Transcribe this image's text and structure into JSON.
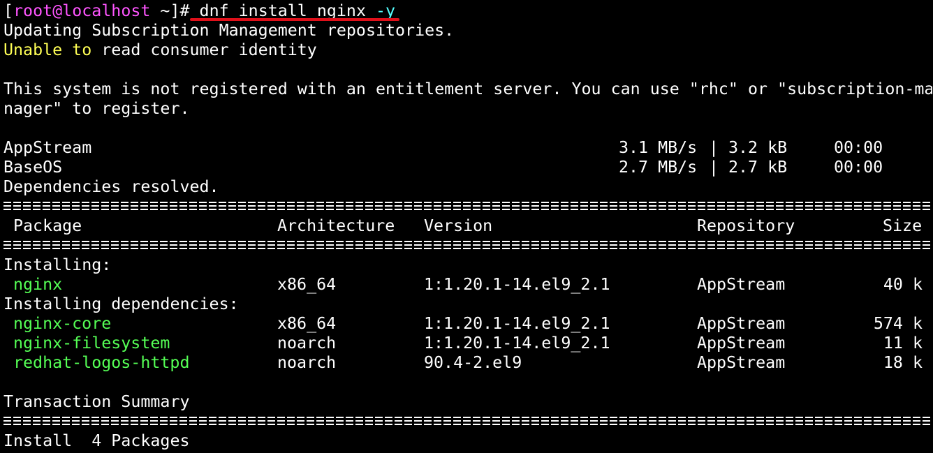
{
  "prompt": {
    "open_bracket": "[",
    "user": "root",
    "at": "@",
    "host": "localhost",
    "cwd_and_symbol": " ~]# ",
    "cmd_main": "dnf install nginx ",
    "cmd_flag": "-y"
  },
  "messages": {
    "updating": "Updating Subscription Management repositories.",
    "unable_word1": "Unable",
    "unable_word2": " to",
    "unable_rest": " read consumer identity",
    "not_registered_line1": "This system is not registered with an entitlement server. You can use \"rhc\" or \"subscription-ma",
    "not_registered_line2": "nager\" to register.",
    "deps_resolved": "Dependencies resolved."
  },
  "repos": [
    {
      "name": "AppStream",
      "speed": "3.1 MB/s",
      "sep": "|",
      "size": "3.2 kB",
      "time": "00:00"
    },
    {
      "name": "BaseOS",
      "speed": "2.7 MB/s",
      "sep": "|",
      "size": "2.7 kB",
      "time": "00:00"
    }
  ],
  "table": {
    "headers": {
      "package": "Package",
      "arch": "Architecture",
      "version": "Version",
      "repo": "Repository",
      "size": "Size"
    },
    "section_installing": "Installing:",
    "section_deps": "Installing dependencies:",
    "installing": [
      {
        "package": "nginx",
        "arch": "x86_64",
        "version": "1:1.20.1-14.el9_2.1",
        "repo": "AppStream",
        "size": "40 k"
      }
    ],
    "dependencies": [
      {
        "package": "nginx-core",
        "arch": "x86_64",
        "version": "1:1.20.1-14.el9_2.1",
        "repo": "AppStream",
        "size": "574 k"
      },
      {
        "package": "nginx-filesystem",
        "arch": "noarch",
        "version": "1:1.20.1-14.el9_2.1",
        "repo": "AppStream",
        "size": "11 k"
      },
      {
        "package": "redhat-logos-httpd",
        "arch": "noarch",
        "version": "90.4-2.el9",
        "repo": "AppStream",
        "size": "18 k"
      }
    ]
  },
  "summary": {
    "title": "Transaction Summary",
    "install_line": "Install  4 Packages"
  },
  "colors": {
    "background": "#000000",
    "text": "#ffffff",
    "user": "#ff55ff",
    "host": "#ff55ff",
    "flag": "#55ffff",
    "warning": "#ffff55",
    "package": "#55ff55",
    "annotation_underline": "#e0101a"
  }
}
